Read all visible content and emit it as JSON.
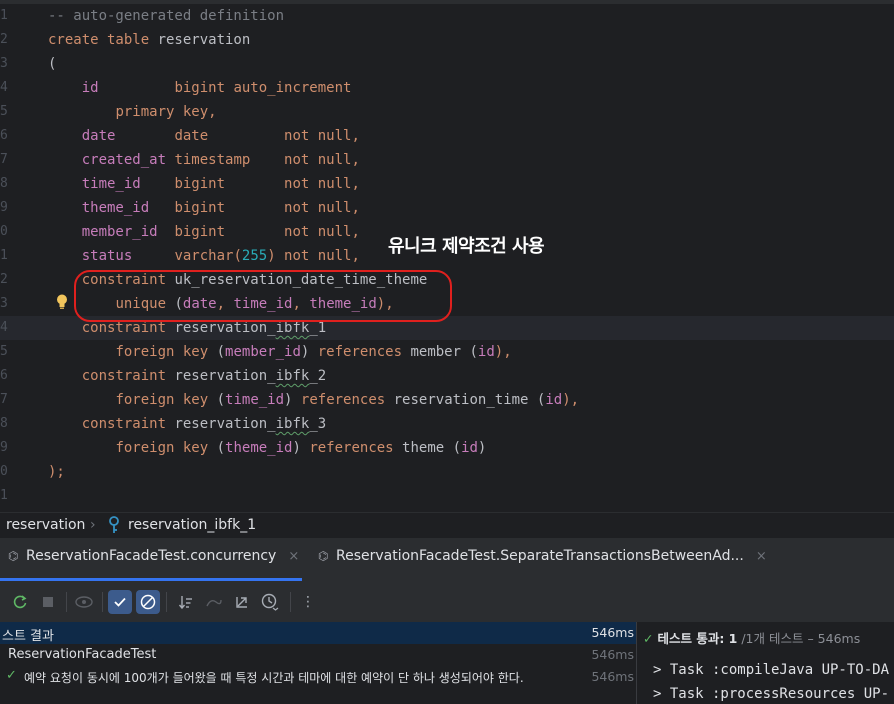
{
  "editor": {
    "line_numbers": [
      "1",
      "2",
      "3",
      "4",
      "5",
      "6",
      "7",
      "8",
      "9",
      "0",
      "1",
      "2",
      "3",
      "4",
      "5",
      "6",
      "7",
      "8",
      "9",
      "0",
      "1"
    ],
    "lines": [
      [
        {
          "t": "-- auto-generated definition",
          "c": "cmt"
        }
      ],
      [
        {
          "t": "create table ",
          "c": "kw"
        },
        {
          "t": "reservation",
          "c": ""
        }
      ],
      [
        {
          "t": "(",
          "c": ""
        }
      ],
      [
        {
          "t": "    ",
          "c": ""
        },
        {
          "t": "id",
          "c": "fld"
        },
        {
          "t": "         ",
          "c": ""
        },
        {
          "t": "bigint auto_increment",
          "c": "kw"
        }
      ],
      [
        {
          "t": "        ",
          "c": ""
        },
        {
          "t": "primary key,",
          "c": "kw"
        }
      ],
      [
        {
          "t": "    ",
          "c": ""
        },
        {
          "t": "date",
          "c": "fld"
        },
        {
          "t": "       ",
          "c": ""
        },
        {
          "t": "date",
          "c": "kw"
        },
        {
          "t": "         ",
          "c": ""
        },
        {
          "t": "not null,",
          "c": "kw"
        }
      ],
      [
        {
          "t": "    ",
          "c": ""
        },
        {
          "t": "created_at",
          "c": "fld"
        },
        {
          "t": " ",
          "c": ""
        },
        {
          "t": "timestamp",
          "c": "kw"
        },
        {
          "t": "    ",
          "c": ""
        },
        {
          "t": "not null,",
          "c": "kw"
        }
      ],
      [
        {
          "t": "    ",
          "c": ""
        },
        {
          "t": "time_id",
          "c": "fld"
        },
        {
          "t": "    ",
          "c": ""
        },
        {
          "t": "bigint",
          "c": "kw"
        },
        {
          "t": "       ",
          "c": ""
        },
        {
          "t": "not null,",
          "c": "kw"
        }
      ],
      [
        {
          "t": "    ",
          "c": ""
        },
        {
          "t": "theme_id",
          "c": "fld"
        },
        {
          "t": "   ",
          "c": ""
        },
        {
          "t": "bigint",
          "c": "kw"
        },
        {
          "t": "       ",
          "c": ""
        },
        {
          "t": "not null,",
          "c": "kw"
        }
      ],
      [
        {
          "t": "    ",
          "c": ""
        },
        {
          "t": "member_id",
          "c": "fld"
        },
        {
          "t": "  ",
          "c": ""
        },
        {
          "t": "bigint",
          "c": "kw"
        },
        {
          "t": "       ",
          "c": ""
        },
        {
          "t": "not null,",
          "c": "kw"
        }
      ],
      [
        {
          "t": "    ",
          "c": ""
        },
        {
          "t": "status",
          "c": "fld"
        },
        {
          "t": "     ",
          "c": ""
        },
        {
          "t": "varchar(",
          "c": "kw"
        },
        {
          "t": "255",
          "c": "num"
        },
        {
          "t": ") not null,",
          "c": "kw"
        }
      ],
      [
        {
          "t": "    ",
          "c": ""
        },
        {
          "t": "constraint ",
          "c": "kw"
        },
        {
          "t": "uk_reservation_date_time_theme",
          "c": ""
        }
      ],
      [
        {
          "t": "        ",
          "c": ""
        },
        {
          "t": "unique ",
          "c": "kw"
        },
        {
          "t": "(",
          "c": ""
        },
        {
          "t": "date",
          "c": "fld"
        },
        {
          "t": ", ",
          "c": "kw"
        },
        {
          "t": "time_id",
          "c": "fld"
        },
        {
          "t": ", ",
          "c": "kw"
        },
        {
          "t": "theme_id",
          "c": "fld"
        },
        {
          "t": "),",
          "c": "kw"
        }
      ],
      [
        {
          "t": "    ",
          "c": ""
        },
        {
          "t": "constraint ",
          "c": "kw"
        },
        {
          "t": "reservation_",
          "c": ""
        },
        {
          "t": "ibfk",
          "c": "ul"
        },
        {
          "t": "_1",
          "c": ""
        }
      ],
      [
        {
          "t": "        ",
          "c": ""
        },
        {
          "t": "foreign key ",
          "c": "kw"
        },
        {
          "t": "(",
          "c": ""
        },
        {
          "t": "member_id",
          "c": "fld"
        },
        {
          "t": ") ",
          "c": ""
        },
        {
          "t": "references ",
          "c": "kw"
        },
        {
          "t": "member (",
          "c": ""
        },
        {
          "t": "id",
          "c": "fld"
        },
        {
          "t": "),",
          "c": "kw"
        }
      ],
      [
        {
          "t": "    ",
          "c": ""
        },
        {
          "t": "constraint ",
          "c": "kw"
        },
        {
          "t": "reservation_",
          "c": ""
        },
        {
          "t": "ibfk",
          "c": "ul"
        },
        {
          "t": "_2",
          "c": ""
        }
      ],
      [
        {
          "t": "        ",
          "c": ""
        },
        {
          "t": "foreign key ",
          "c": "kw"
        },
        {
          "t": "(",
          "c": ""
        },
        {
          "t": "time_id",
          "c": "fld"
        },
        {
          "t": ") ",
          "c": ""
        },
        {
          "t": "references ",
          "c": "kw"
        },
        {
          "t": "reservation_time (",
          "c": ""
        },
        {
          "t": "id",
          "c": "fld"
        },
        {
          "t": "),",
          "c": "kw"
        }
      ],
      [
        {
          "t": "    ",
          "c": ""
        },
        {
          "t": "constraint ",
          "c": "kw"
        },
        {
          "t": "reservation_",
          "c": ""
        },
        {
          "t": "ibfk",
          "c": "ul"
        },
        {
          "t": "_3",
          "c": ""
        }
      ],
      [
        {
          "t": "        ",
          "c": ""
        },
        {
          "t": "foreign key ",
          "c": "kw"
        },
        {
          "t": "(",
          "c": ""
        },
        {
          "t": "theme_id",
          "c": "fld"
        },
        {
          "t": ") ",
          "c": ""
        },
        {
          "t": "references ",
          "c": "kw"
        },
        {
          "t": "theme (",
          "c": ""
        },
        {
          "t": "id",
          "c": "fld"
        },
        {
          "t": ")",
          "c": ""
        }
      ],
      [
        {
          "t": ");",
          "c": "kw"
        }
      ],
      [
        {
          "t": "",
          "c": ""
        }
      ]
    ],
    "current_line": 13,
    "annotation": "유니크 제약조건 사용",
    "bulb_icon": "lightbulb-icon"
  },
  "breadcrumb": {
    "table": "reservation",
    "separator": "›",
    "key_icon": "key-icon",
    "item": "reservation_ibfk_1"
  },
  "tabs": [
    {
      "label": "ReservationFacadeTest.concurrency",
      "icon": "test-icon",
      "close": "×"
    },
    {
      "label": "ReservationFacadeTest.SeparateTransactionsBetweenAd...",
      "icon": "test-icon",
      "close": "×"
    }
  ],
  "toolbar": {
    "more": "⋮"
  },
  "results": {
    "header_label": "스트 결과",
    "header_time": "546ms",
    "class_label": "ReservationFacadeTest",
    "class_time": "546ms",
    "test_label": "예약 요청이 동시에 100개가 들어왔을 때 특정 시간과 테마에 대한 예약이 단 하나 생성되어야 한다.",
    "test_time": "546ms"
  },
  "console": {
    "pass_label": "테스트 통과: 1",
    "pass_detail": " /1개 테스트 – 546ms",
    "tasks": [
      "> Task :compileJava UP-TO-DA",
      "> Task :processResources UP-"
    ]
  },
  "colors": {
    "background": "#1e1f22",
    "keyword": "#cf8e6d",
    "field": "#c77dbb",
    "number": "#2aacb8",
    "highlight_circle": "#e0201e",
    "pass_check": "#5fb865"
  }
}
